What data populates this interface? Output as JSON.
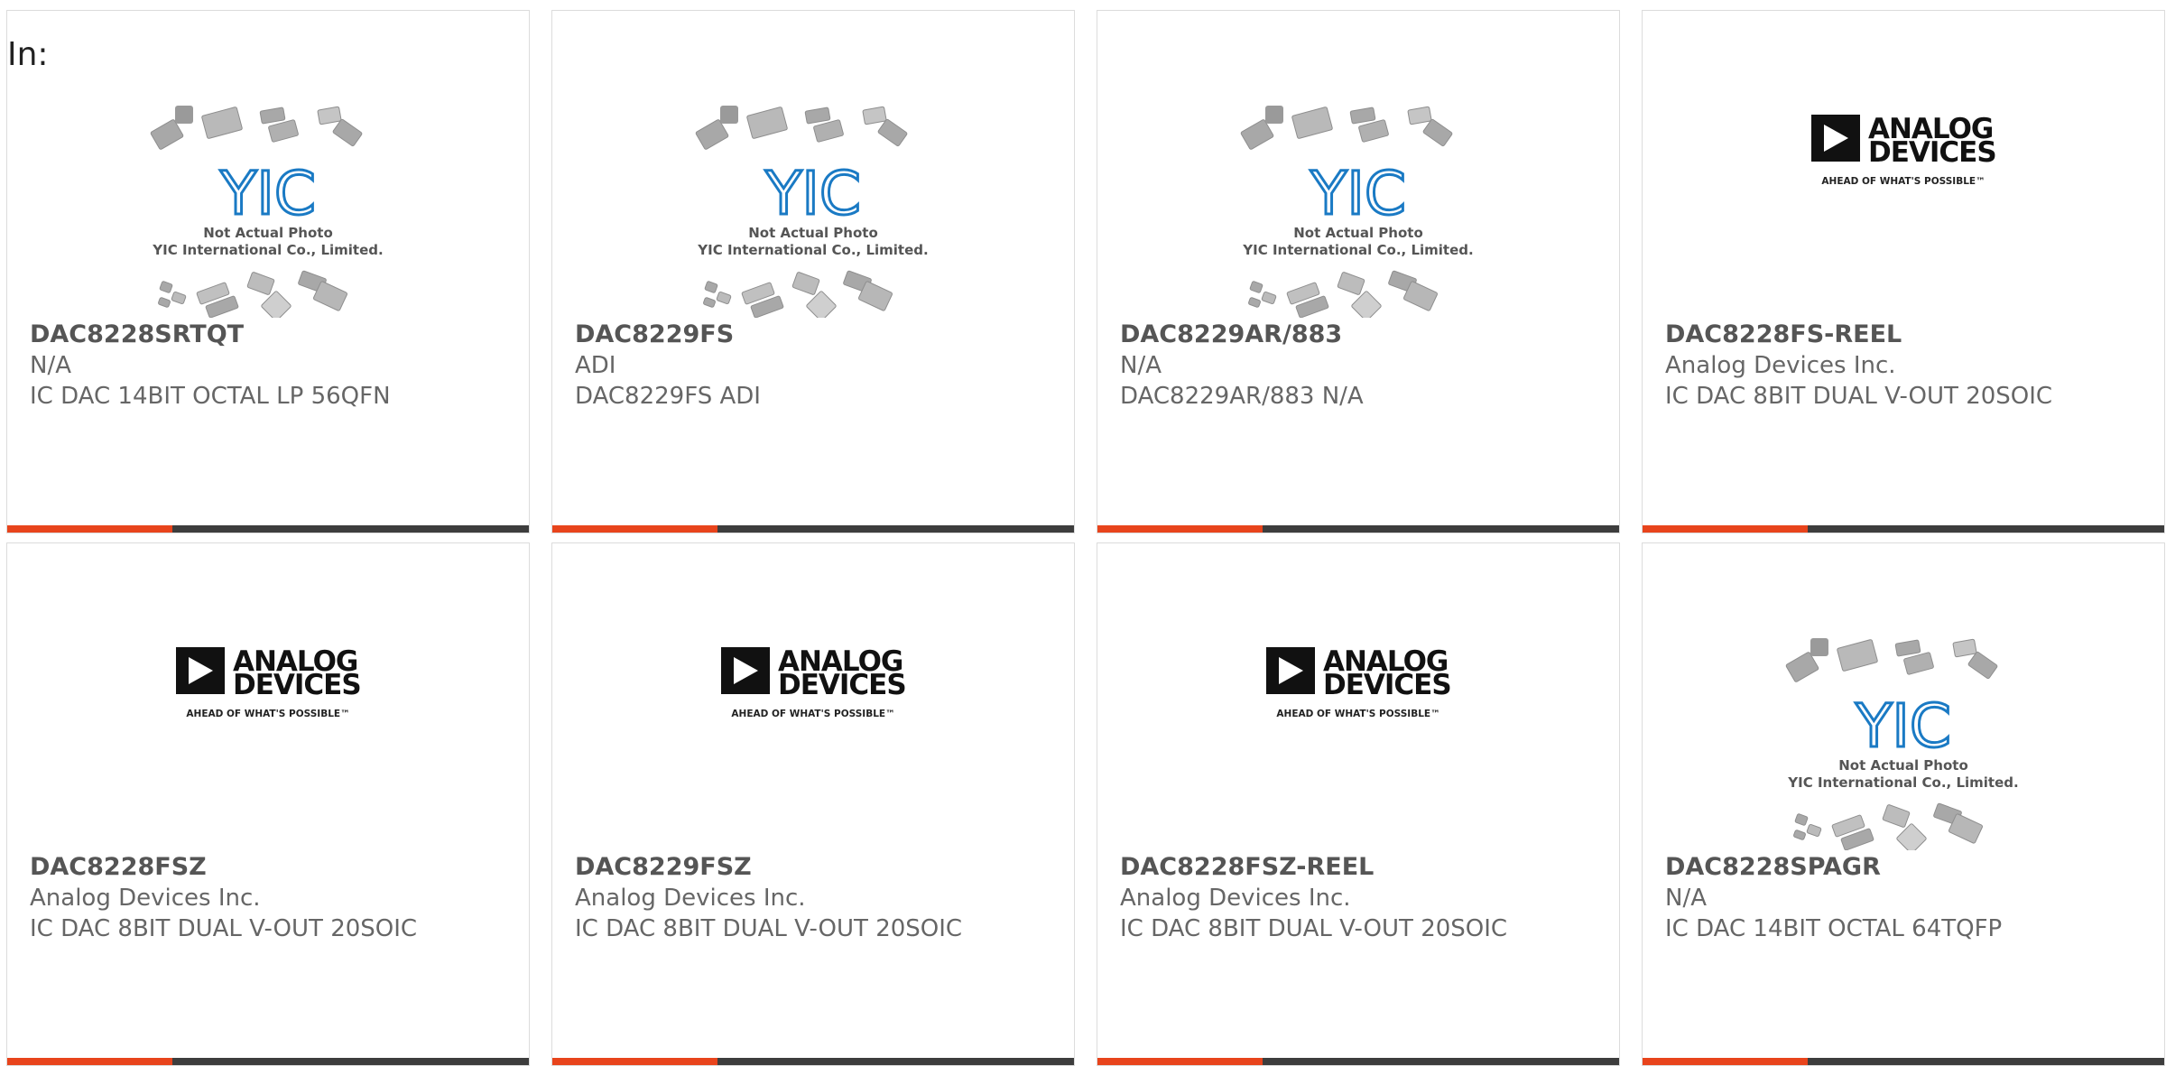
{
  "header": {
    "in_label": "In:"
  },
  "colors": {
    "accent": "#e8441c",
    "bar_dark": "#3d3d3d",
    "yic_blue": "#1a7ac4",
    "adi_black": "#111111",
    "chip_gray": "#a8a8a8"
  },
  "placeholder": {
    "brand": "YIC",
    "line1": "Not Actual Photo",
    "line2": "YIC International Co., Limited."
  },
  "adi_logo": {
    "line1": "ANALOG",
    "line2": "DEVICES",
    "tagline": "AHEAD OF WHAT'S POSSIBLE™"
  },
  "products": [
    {
      "part": "DAC8228SRTQT",
      "manufacturer": "N/A",
      "description": "IC DAC 14BIT OCTAL LP 56QFN",
      "image": "yic-placeholder"
    },
    {
      "part": "DAC8229FS",
      "manufacturer": "ADI",
      "description": "DAC8229FS ADI",
      "image": "yic-placeholder"
    },
    {
      "part": "DAC8229AR/883",
      "manufacturer": "N/A",
      "description": "DAC8229AR/883 N/A",
      "image": "yic-placeholder"
    },
    {
      "part": "DAC8228FS-REEL",
      "manufacturer": "Analog Devices Inc.",
      "description": "IC DAC 8BIT DUAL V-OUT 20SOIC",
      "image": "adi-logo"
    },
    {
      "part": "DAC8228FSZ",
      "manufacturer": "Analog Devices Inc.",
      "description": "IC DAC 8BIT DUAL V-OUT 20SOIC",
      "image": "adi-logo"
    },
    {
      "part": "DAC8229FSZ",
      "manufacturer": "Analog Devices Inc.",
      "description": "IC DAC 8BIT DUAL V-OUT 20SOIC",
      "image": "adi-logo"
    },
    {
      "part": "DAC8228FSZ-REEL",
      "manufacturer": "Analog Devices Inc.",
      "description": "IC DAC 8BIT DUAL V-OUT 20SOIC",
      "image": "adi-logo"
    },
    {
      "part": "DAC8228SPAGR",
      "manufacturer": "N/A",
      "description": "IC DAC 14BIT OCTAL 64TQFP",
      "image": "yic-placeholder"
    }
  ]
}
